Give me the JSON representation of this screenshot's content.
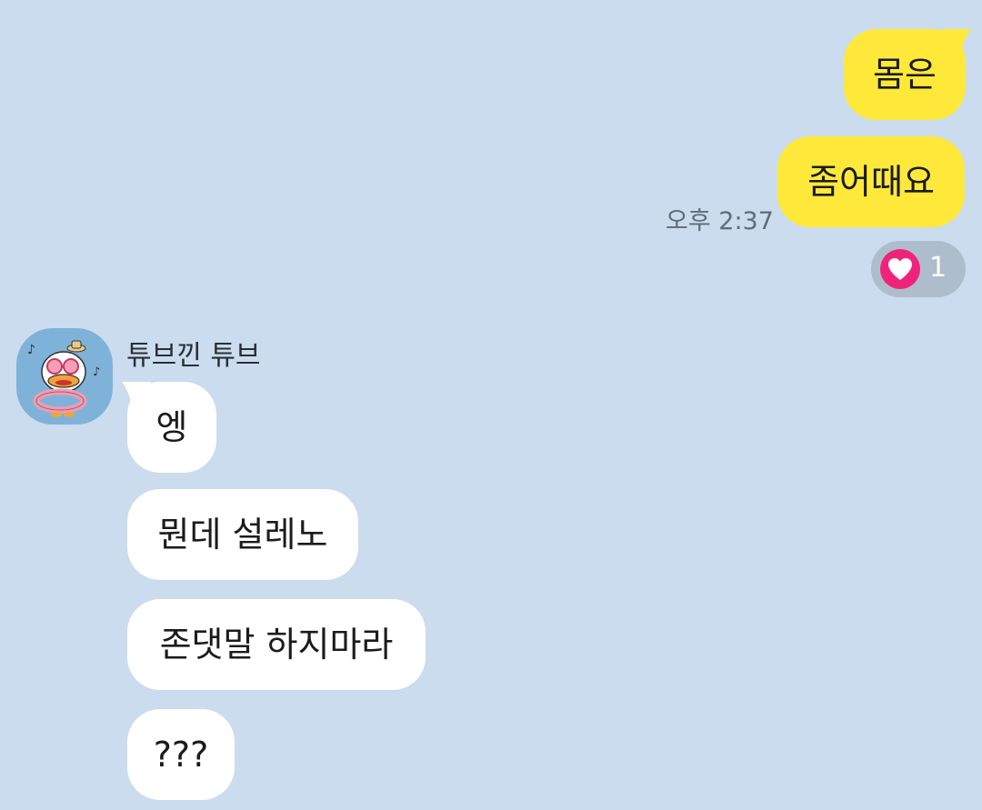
{
  "colors": {
    "background": "#cbdcee",
    "my_bubble": "#fee93a",
    "their_bubble": "#ffffff",
    "reaction_bg": "#aebdcc",
    "heart": "#f0237a"
  },
  "messages_sent": [
    {
      "text": "몸은"
    },
    {
      "text": "좀어때요"
    }
  ],
  "sent_time": "오후 2:37",
  "reaction": {
    "icon": "heart-icon",
    "count": "1"
  },
  "sender": {
    "name": "튜브낀 튜브",
    "avatar_icon": "duck-character-avatar"
  },
  "messages_received": [
    {
      "text": "엥"
    },
    {
      "text": "뭔데 설레노"
    },
    {
      "text": "존댓말 하지마라"
    },
    {
      "text": "???"
    }
  ]
}
